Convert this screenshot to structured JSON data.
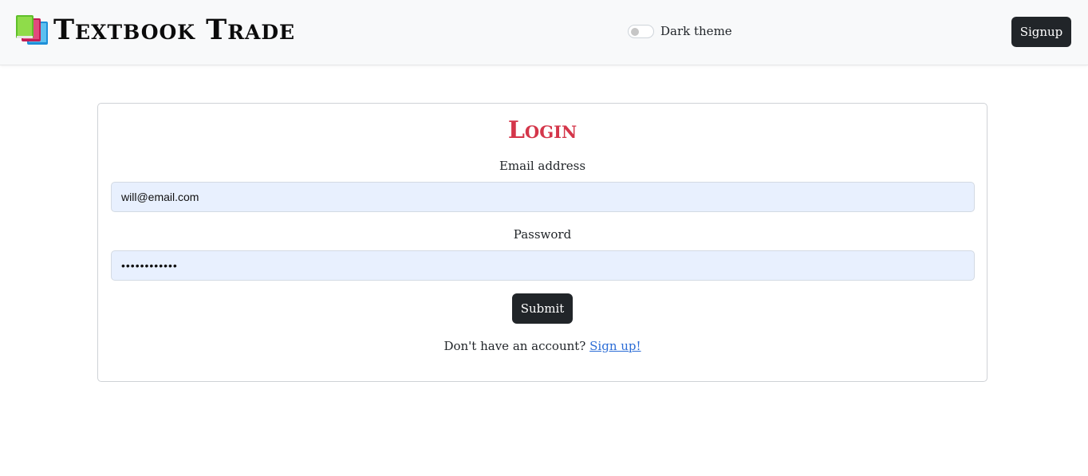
{
  "navbar": {
    "brand_title": "Textbook Trade",
    "brand_icon": "books-icon",
    "theme_toggle_label": "Dark theme",
    "theme_toggle_on": false,
    "signup_label": "Signup"
  },
  "login": {
    "title": "Login",
    "email_label": "Email address",
    "email_value": "will@email.com",
    "password_label": "Password",
    "password_value": "••••••••••••",
    "submit_label": "Submit",
    "signup_prompt": "Don't have an account?",
    "signup_link": "Sign up!"
  },
  "colors": {
    "title_accent": "#d4364a",
    "button_dark": "#212529",
    "link": "#2c6dd6",
    "input_fill": "#e8f0fe"
  }
}
